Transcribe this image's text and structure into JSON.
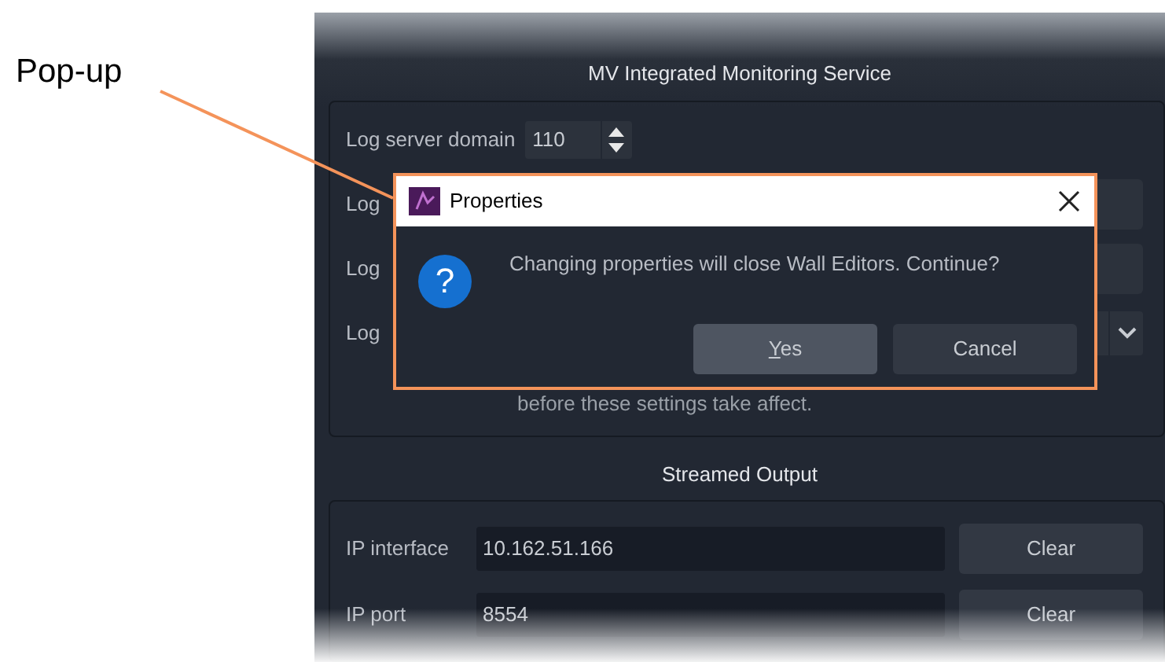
{
  "annotation": {
    "label": "Pop-up"
  },
  "panel": {
    "title": "MV Integrated Monitoring Service",
    "log_rows": [
      {
        "kind": "spin",
        "label": "Log server domain",
        "value": "110"
      },
      {
        "kind": "field",
        "label": "Log"
      },
      {
        "kind": "field",
        "label": "Log"
      },
      {
        "kind": "combo",
        "label": "Log"
      }
    ],
    "note": "before these settings take affect.",
    "stream_title": "Streamed Output",
    "stream_rows": [
      {
        "label": "IP interface",
        "value": "10.162.51.166",
        "button": "Clear"
      },
      {
        "label": "IP port",
        "value": "8554",
        "button": "Clear"
      }
    ]
  },
  "dialog": {
    "title": "Properties",
    "message": "Changing properties will close Wall Editors. Continue?",
    "icon": "?",
    "buttons": [
      {
        "label": "Yes",
        "default": true
      },
      {
        "label": "Cancel",
        "default": false
      }
    ]
  }
}
